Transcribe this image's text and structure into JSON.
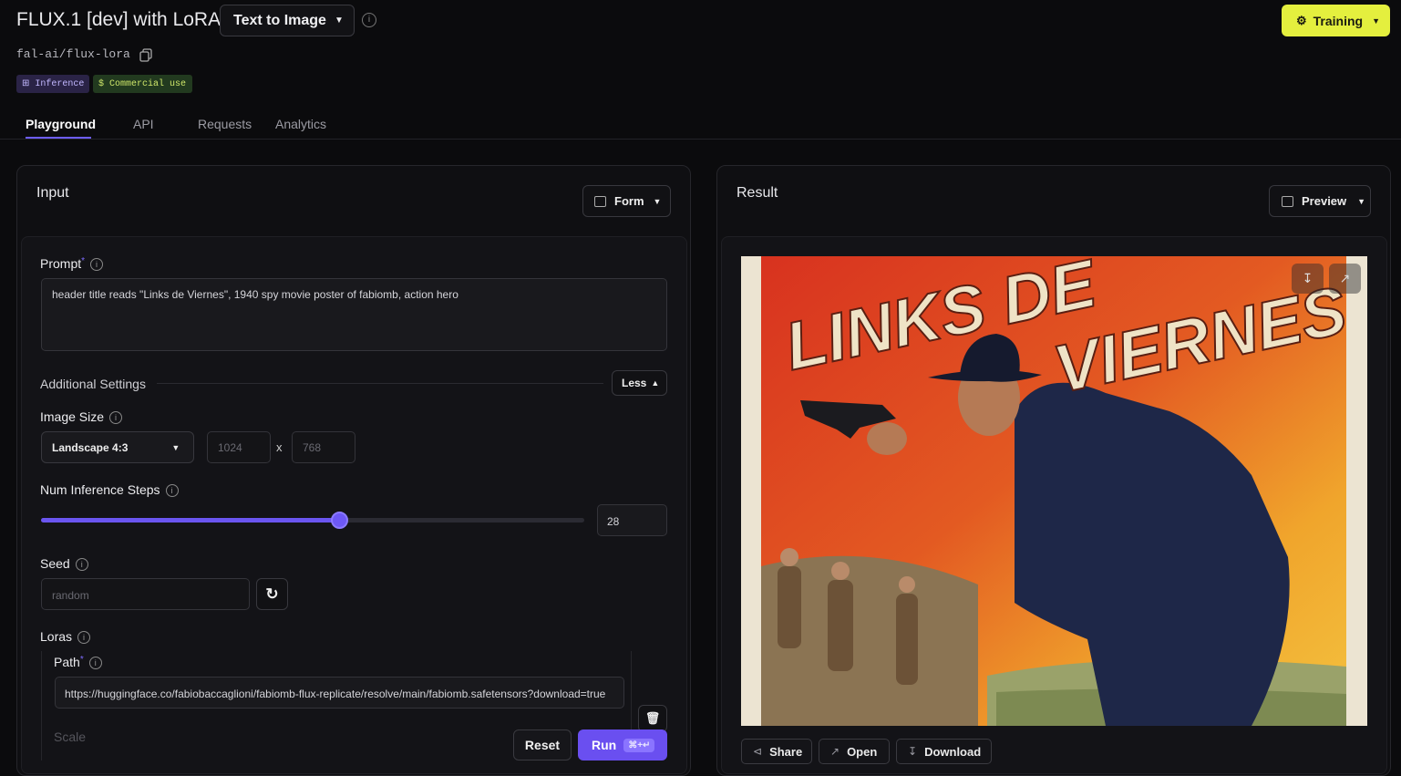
{
  "header": {
    "title": "FLUX.1 [dev] with LoRAs",
    "mode": "Text to Image",
    "model_id": "fal-ai/flux-lora",
    "badges": [
      {
        "icon": "grid-icon",
        "label": "Inference"
      },
      {
        "icon": "dollar-icon",
        "label": "Commercial use"
      }
    ],
    "training_label": "Training",
    "accent_color": "#e4ef3e"
  },
  "tabs": [
    {
      "label": "Playground",
      "active": true
    },
    {
      "label": "API",
      "active": false
    },
    {
      "label": "Requests",
      "active": false
    },
    {
      "label": "Analytics",
      "active": false
    }
  ],
  "input": {
    "title": "Input",
    "view_mode": "Form",
    "prompt_label": "Prompt",
    "prompt_required": "*",
    "prompt_value": "header title reads \"Links de Viernes\", 1940 spy movie poster of fabiomb, action hero",
    "additional_settings_label": "Additional Settings",
    "less_label": "Less",
    "image_size_label": "Image Size",
    "image_size_value": "Landscape 4:3",
    "width_placeholder": "1024",
    "height_placeholder": "768",
    "times_sign": "x",
    "steps_label": "Num Inference Steps",
    "steps_value": "28",
    "steps_fraction": 0.55,
    "seed_label": "Seed",
    "seed_placeholder": "random",
    "loras_label": "Loras",
    "path_label": "Path",
    "path_required": "*",
    "path_value": "https://huggingface.co/fabiobaccaglioni/fabiomb-flux-replicate/resolve/main/fabiomb.safetensors?download=true",
    "scale_label": "Scale",
    "reset_label": "Reset",
    "run_label": "Run",
    "run_shortcut": "⌘+↵"
  },
  "result": {
    "title": "Result",
    "view_mode": "Preview",
    "poster_title_line1": "LINKS DE",
    "poster_title_line2": "VIERNES",
    "actions": [
      "Share",
      "Open",
      "Download"
    ]
  }
}
